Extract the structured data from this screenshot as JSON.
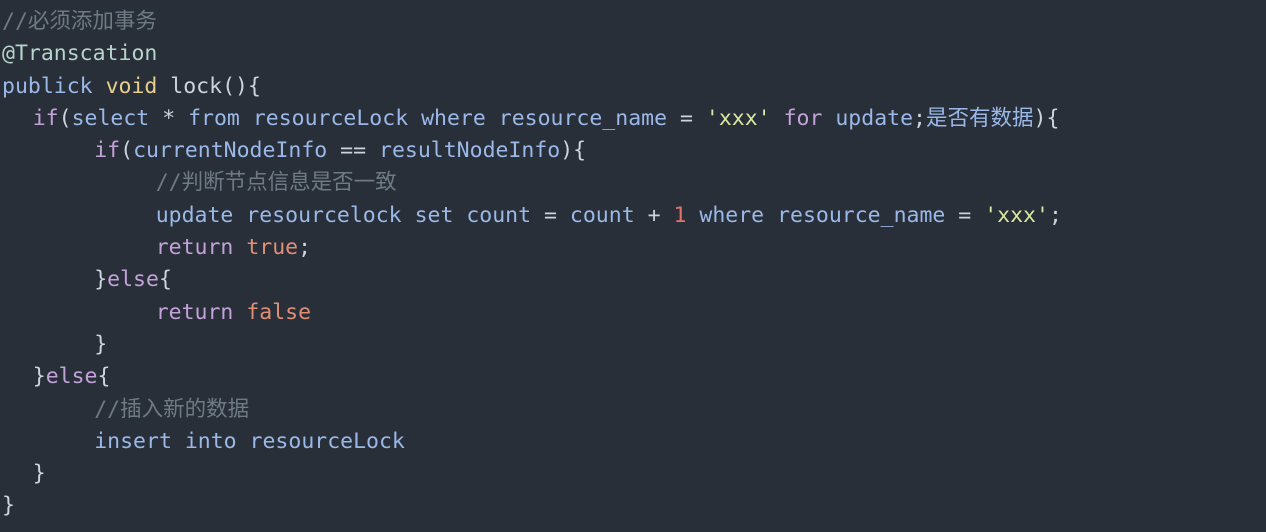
{
  "editor": {
    "theme": "dark-slate",
    "background_color": "#282f38",
    "font_size_px": 21.5,
    "line_height_px": 32.3,
    "language": "java",
    "colors": {
      "comment": "#6e7a85",
      "annotation": "#b6d3cc",
      "keyword": "#c3a2da",
      "type": "#e6d08c",
      "identifier": "#9ab8e8",
      "plain": "#ccd4de",
      "string": "#dbe8a1",
      "number": "#e2736a",
      "boolean": "#e08f76"
    }
  },
  "code": {
    "lines": [
      {
        "n": 1,
        "indent": 0,
        "tokens": [
          {
            "c": "t-comment",
            "t": "//必须添加事务"
          }
        ]
      },
      {
        "n": 2,
        "indent": 0,
        "tokens": [
          {
            "c": "t-anno",
            "t": "@Transcation"
          }
        ]
      },
      {
        "n": 3,
        "indent": 0,
        "tokens": [
          {
            "c": "t-ident",
            "t": "publick"
          },
          {
            "c": "t-plain",
            "t": " "
          },
          {
            "c": "t-type",
            "t": "void"
          },
          {
            "c": "t-plain",
            "t": " lock(){"
          }
        ]
      },
      {
        "n": 4,
        "indent": 2,
        "tokens": [
          {
            "c": "t-keyword",
            "t": "if"
          },
          {
            "c": "t-plain",
            "t": "("
          },
          {
            "c": "t-ident",
            "t": "select"
          },
          {
            "c": "t-plain",
            "t": " * "
          },
          {
            "c": "t-ident",
            "t": "from resourceLock where resource_name"
          },
          {
            "c": "t-plain",
            "t": " = "
          },
          {
            "c": "t-string",
            "t": "'xxx'"
          },
          {
            "c": "t-plain",
            "t": " "
          },
          {
            "c": "t-keyword",
            "t": "for"
          },
          {
            "c": "t-plain",
            "t": " "
          },
          {
            "c": "t-ident",
            "t": "update"
          },
          {
            "c": "t-plain",
            "t": ";"
          },
          {
            "c": "t-ident",
            "t": "是否有数据"
          },
          {
            "c": "t-plain",
            "t": ")"
          },
          {
            "c": "t-plain",
            "t": "{"
          }
        ]
      },
      {
        "n": 5,
        "indent": 6,
        "tokens": [
          {
            "c": "t-keyword",
            "t": "if"
          },
          {
            "c": "t-plain",
            "t": "("
          },
          {
            "c": "t-ident",
            "t": "currentNodeInfo"
          },
          {
            "c": "t-plain",
            "t": " == "
          },
          {
            "c": "t-ident",
            "t": "resultNodeInfo"
          },
          {
            "c": "t-plain",
            "t": "){"
          }
        ]
      },
      {
        "n": 6,
        "indent": 10,
        "tokens": [
          {
            "c": "t-comment",
            "t": "//判断节点信息是否一致"
          }
        ]
      },
      {
        "n": 7,
        "indent": 10,
        "tokens": [
          {
            "c": "t-ident",
            "t": "update resourcelock set count"
          },
          {
            "c": "t-plain",
            "t": " = "
          },
          {
            "c": "t-ident",
            "t": "count"
          },
          {
            "c": "t-plain",
            "t": " + "
          },
          {
            "c": "t-number",
            "t": "1"
          },
          {
            "c": "t-plain",
            "t": " "
          },
          {
            "c": "t-ident",
            "t": "where resource_name"
          },
          {
            "c": "t-plain",
            "t": " = "
          },
          {
            "c": "t-string",
            "t": "'xxx'"
          },
          {
            "c": "t-plain",
            "t": ";"
          }
        ]
      },
      {
        "n": 8,
        "indent": 10,
        "tokens": [
          {
            "c": "t-keyword",
            "t": "return"
          },
          {
            "c": "t-plain",
            "t": " "
          },
          {
            "c": "t-bool",
            "t": "true"
          },
          {
            "c": "t-plain",
            "t": ";"
          }
        ]
      },
      {
        "n": 9,
        "indent": 6,
        "tokens": [
          {
            "c": "t-plain",
            "t": "}"
          },
          {
            "c": "t-keyword",
            "t": "else"
          },
          {
            "c": "t-plain",
            "t": "{"
          }
        ]
      },
      {
        "n": 10,
        "indent": 10,
        "tokens": [
          {
            "c": "t-keyword",
            "t": "return"
          },
          {
            "c": "t-plain",
            "t": " "
          },
          {
            "c": "t-bool",
            "t": "false"
          }
        ]
      },
      {
        "n": 11,
        "indent": 6,
        "tokens": [
          {
            "c": "t-plain",
            "t": "}"
          }
        ]
      },
      {
        "n": 12,
        "indent": 2,
        "tokens": [
          {
            "c": "t-plain",
            "t": "}"
          },
          {
            "c": "t-keyword",
            "t": "else"
          },
          {
            "c": "t-plain",
            "t": "{"
          }
        ]
      },
      {
        "n": 13,
        "indent": 6,
        "tokens": [
          {
            "c": "t-comment",
            "t": "//插入新的数据"
          }
        ]
      },
      {
        "n": 14,
        "indent": 6,
        "tokens": [
          {
            "c": "t-ident",
            "t": "insert into resourceLock"
          }
        ]
      },
      {
        "n": 15,
        "indent": 2,
        "tokens": [
          {
            "c": "t-plain",
            "t": "}"
          }
        ]
      },
      {
        "n": 16,
        "indent": 0,
        "tokens": [
          {
            "c": "t-plain",
            "t": "}"
          }
        ]
      }
    ],
    "plain_text": "//必须添加事务\n@Transcation\npublick void lock(){\n  if(select * from resourceLock where resource_name = 'xxx' for update;是否有数据){\n      if(currentNodeInfo == resultNodeInfo){\n          //判断节点信息是否一致\n          update resourcelock set count = count + 1 where resource_name = 'xxx';\n          return true;\n      }else{\n          return false\n      }\n  }else{\n      //插入新的数据\n      insert into resourceLock\n  }\n}"
  }
}
